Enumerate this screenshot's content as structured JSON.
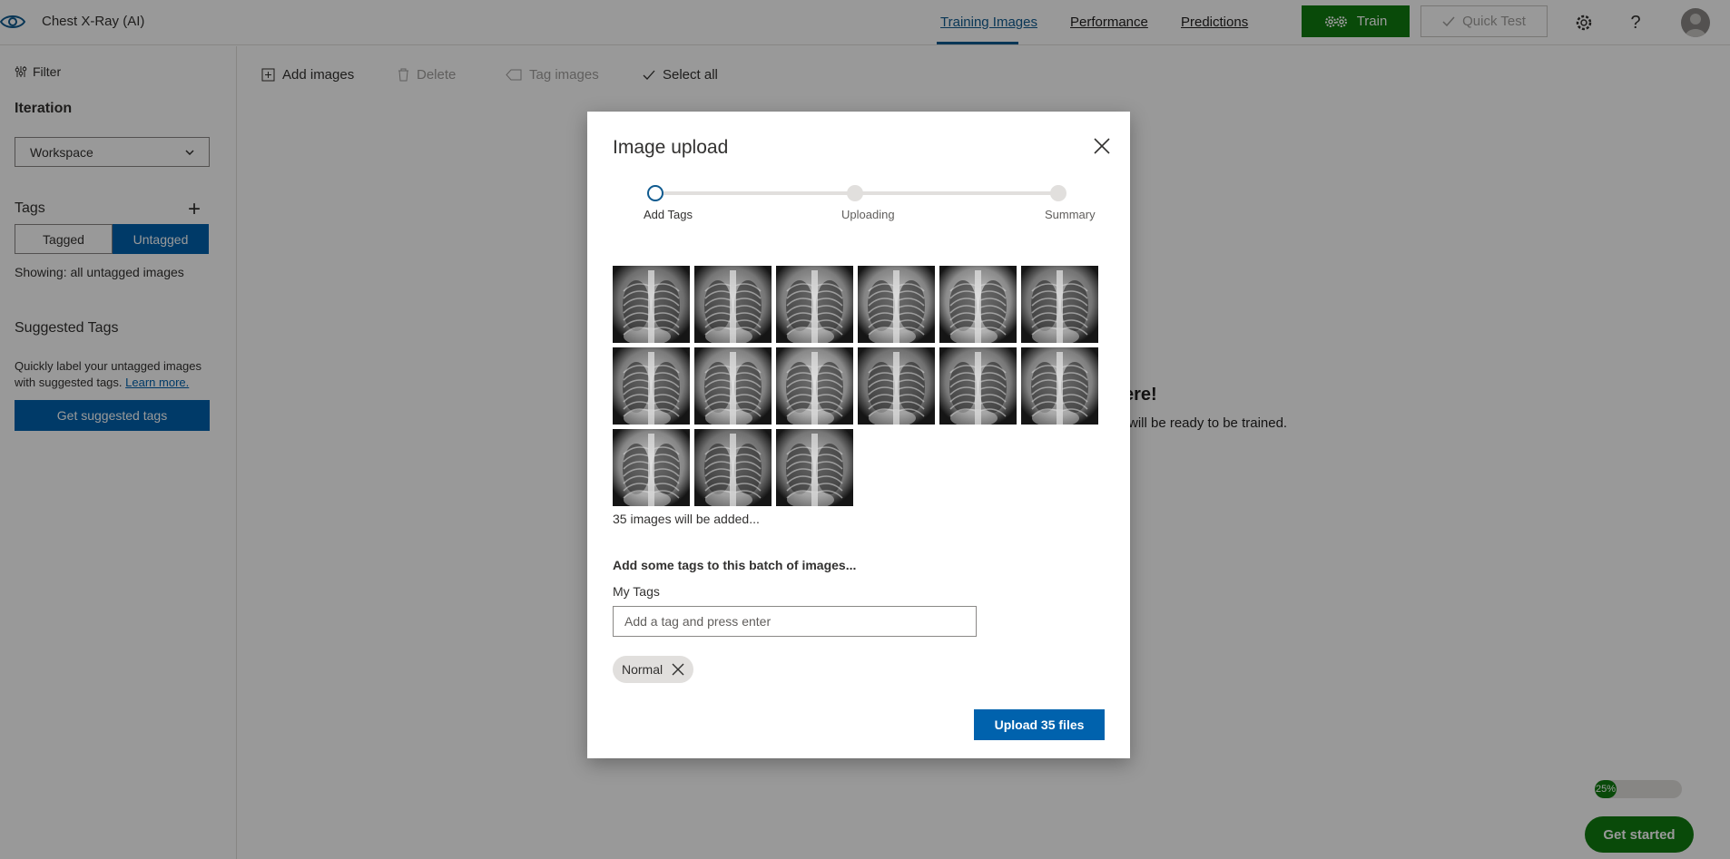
{
  "app": {
    "title": "Chest X-Ray (AI)",
    "logo_icon": "eye-icon"
  },
  "nav": {
    "tabs": [
      {
        "label": "Training Images",
        "active": true
      },
      {
        "label": "Performance",
        "active": false
      },
      {
        "label": "Predictions",
        "active": false
      }
    ],
    "train_label": "Train",
    "quick_test_label": "Quick Test",
    "settings_icon": "gear-icon",
    "help_label": "?"
  },
  "sidebar": {
    "filter_label": "Filter",
    "iteration_heading": "Iteration",
    "iteration_selected": "Workspace",
    "tags_heading": "Tags",
    "tags_plus": "+",
    "toggle_tagged": "Tagged",
    "toggle_untagged": "Untagged",
    "showing_text": "Showing: all untagged images",
    "suggested_heading": "Suggested Tags",
    "suggested_desc": "Quickly label your untagged images with suggested tags.",
    "learn_more": "Learn more.",
    "suggested_button": "Get suggested tags"
  },
  "toolbar": {
    "add_images": "Add images",
    "delete": "Delete",
    "tag_images": "Tag images",
    "select_all": "Select all"
  },
  "background": {
    "heading_fragment": "ere!",
    "sub_fragment": "will be ready to be trained.",
    "progress_percent": 25,
    "progress_label": "25%",
    "get_started": "Get started"
  },
  "modal": {
    "title": "Image upload",
    "steps": [
      "Add Tags",
      "Uploading",
      "Summary"
    ],
    "active_step": 0,
    "thumbnail_count": 15,
    "count_text": "35 images will be added...",
    "batch_text": "Add some tags to this batch of images...",
    "my_tags_label": "My Tags",
    "tag_input_placeholder": "Add a tag and press enter",
    "tags": [
      "Normal"
    ],
    "upload_button": "Upload 35 files"
  },
  "colors": {
    "brand_blue": "#0062ad",
    "train_green": "#107c10",
    "nav_active": "#0f5a8f"
  }
}
